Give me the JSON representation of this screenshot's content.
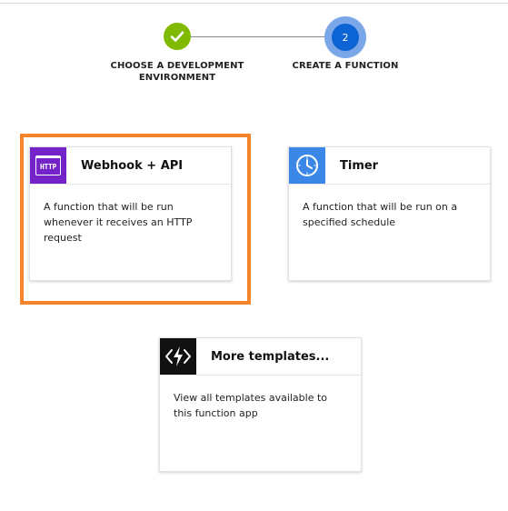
{
  "stepper": {
    "step1": {
      "label_line1": "CHOOSE A DEVELOPMENT",
      "label_line2": "ENVIRONMENT",
      "icon": "checkmark-icon",
      "status": "completed",
      "color": "#7fba00"
    },
    "step2": {
      "number": "2",
      "label": "CREATE A FUNCTION",
      "status": "active",
      "color": "#0b63d4"
    }
  },
  "templates": [
    {
      "title": "Webhook + API",
      "icon": "http-icon",
      "icon_text": "HTTP",
      "description": "A function that will be run whenever it receives an HTTP request",
      "tile_color": "#7323c7",
      "selected": true
    },
    {
      "title": "Timer",
      "icon": "clock-icon",
      "description": "A function that will be run on a specified schedule",
      "tile_color": "#3b87e8",
      "selected": false
    },
    {
      "title": "More templates...",
      "icon": "function-bolt-icon",
      "description": "View all templates available to this function app",
      "tile_color": "#111111",
      "selected": false
    }
  ],
  "colors": {
    "selection_border": "#f5842b"
  }
}
